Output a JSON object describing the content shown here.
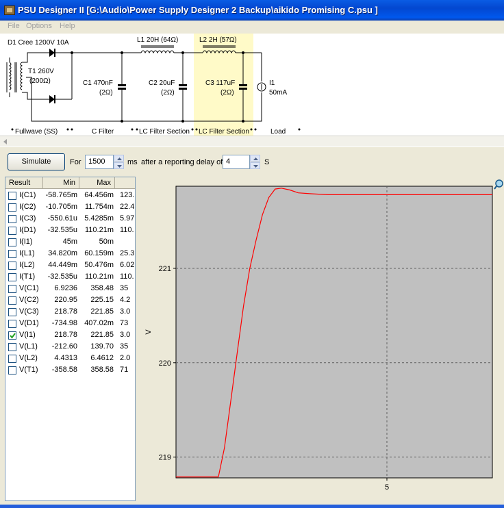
{
  "window": {
    "title": "PSU Designer II  [G:\\Audio\\Power Supply Designer 2 Backup\\aikido Promising C.psu ]"
  },
  "menu": [
    "File",
    "Options",
    "Help"
  ],
  "schematic": {
    "d1_label": "D1 Cree 1200V 10A",
    "t1_label": "T1 260V",
    "t1_res": "(200Ω)",
    "c1_label": "C1 470nF",
    "c1_res": "(2Ω)",
    "l1_label": "L1 20H (64Ω)",
    "c2_label": "C2 20uF",
    "c2_res": "(2Ω)",
    "l2_label": "L2 2H (57Ω)",
    "c3_label": "C3 117uF",
    "c3_res": "(2Ω)",
    "i1_label": "I1",
    "i1_value": "50mA",
    "sections": [
      "Fullwave (SS)",
      "C Filter",
      "LC Filter Section",
      "LC Filter Section",
      "Load"
    ]
  },
  "toolbar": {
    "simulate": "Simulate",
    "for_label": "For",
    "duration": "1500",
    "ms_label": "ms",
    "delay_label": "after a reporting delay of",
    "delay": "4",
    "s_label": "S"
  },
  "table": {
    "headers": [
      "Result",
      "Min",
      "Max",
      ""
    ],
    "rows": [
      {
        "name": "I(C1)",
        "min": "-58.765m",
        "max": "64.456m",
        "range": "123.",
        "checked": false
      },
      {
        "name": "I(C2)",
        "min": "-10.705m",
        "max": "11.754m",
        "range": "22.4",
        "checked": false
      },
      {
        "name": "I(C3)",
        "min": "-550.61u",
        "max": "5.4285m",
        "range": "5.97",
        "checked": false
      },
      {
        "name": "I(D1)",
        "min": "-32.535u",
        "max": "110.21m",
        "range": "110.",
        "checked": false
      },
      {
        "name": "I(I1)",
        "min": "45m",
        "max": "50m",
        "range": "",
        "checked": false
      },
      {
        "name": "I(L1)",
        "min": "34.820m",
        "max": "60.159m",
        "range": "25.3",
        "checked": false
      },
      {
        "name": "I(L2)",
        "min": "44.449m",
        "max": "50.476m",
        "range": "6.02",
        "checked": false
      },
      {
        "name": "I(T1)",
        "min": "-32.535u",
        "max": "110.21m",
        "range": "110.",
        "checked": false
      },
      {
        "name": "V(C1)",
        "min": "6.9236",
        "max": "358.48",
        "range": "35",
        "checked": false
      },
      {
        "name": "V(C2)",
        "min": "220.95",
        "max": "225.15",
        "range": "4.2",
        "checked": false
      },
      {
        "name": "V(C3)",
        "min": "218.78",
        "max": "221.85",
        "range": "3.0",
        "checked": false
      },
      {
        "name": "V(D1)",
        "min": "-734.98",
        "max": "407.02m",
        "range": "73",
        "checked": false
      },
      {
        "name": "V(I1)",
        "min": "218.78",
        "max": "221.85",
        "range": "3.0",
        "checked": true
      },
      {
        "name": "V(L1)",
        "min": "-212.60",
        "max": "139.70",
        "range": "35",
        "checked": false
      },
      {
        "name": "V(L2)",
        "min": "4.4313",
        "max": "6.4612",
        "range": "2.0",
        "checked": false
      },
      {
        "name": "V(T1)",
        "min": "-358.58",
        "max": "358.58",
        "range": "71",
        "checked": false
      }
    ]
  },
  "chart_data": {
    "type": "line",
    "ylabel": "V",
    "y_ticks": [
      "221",
      "220",
      "219"
    ],
    "x_ticks": [
      "5"
    ],
    "grid": true,
    "series": [
      {
        "color": "#ff0000",
        "points": [
          [
            0.0,
            218.79
          ],
          [
            0.5,
            218.79
          ],
          [
            1.0,
            218.79
          ],
          [
            1.01,
            218.8
          ],
          [
            1.15,
            219.1
          ],
          [
            1.3,
            219.6
          ],
          [
            1.45,
            220.1
          ],
          [
            1.6,
            220.6
          ],
          [
            1.75,
            221.0
          ],
          [
            1.9,
            221.3
          ],
          [
            2.05,
            221.57
          ],
          [
            2.2,
            221.75
          ],
          [
            2.35,
            221.84
          ],
          [
            2.5,
            221.85
          ],
          [
            2.7,
            221.83
          ],
          [
            2.9,
            221.8
          ],
          [
            3.2,
            221.79
          ],
          [
            3.6,
            221.78
          ],
          [
            4.5,
            221.78
          ],
          [
            5.5,
            221.78
          ],
          [
            7.5,
            221.78
          ]
        ]
      }
    ],
    "xlim": [
      0.0,
      7.5
    ],
    "ylim": [
      218.78,
      221.87
    ]
  }
}
